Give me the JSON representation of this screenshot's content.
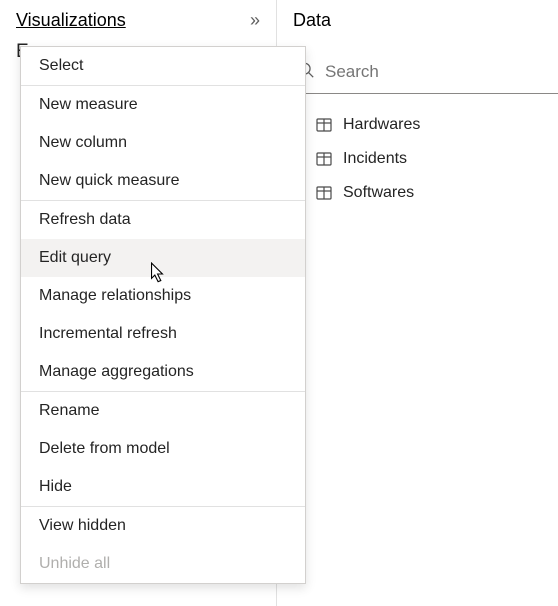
{
  "viz_pane": {
    "title": "Visualizations",
    "partial": "E"
  },
  "data_pane": {
    "title": "Data",
    "search_placeholder": "Search"
  },
  "tables": [
    {
      "label": "Hardwares"
    },
    {
      "label": "Incidents"
    },
    {
      "label": "Softwares"
    }
  ],
  "context_menu": {
    "items": [
      {
        "label": "Select",
        "disabled": false,
        "sep_after": true
      },
      {
        "label": "New measure",
        "disabled": false
      },
      {
        "label": "New column",
        "disabled": false
      },
      {
        "label": "New quick measure",
        "disabled": false,
        "sep_after": true
      },
      {
        "label": "Refresh data",
        "disabled": false
      },
      {
        "label": "Edit query",
        "disabled": false,
        "hover": true
      },
      {
        "label": "Manage relationships",
        "disabled": false
      },
      {
        "label": "Incremental refresh",
        "disabled": false
      },
      {
        "label": "Manage aggregations",
        "disabled": false,
        "sep_after": true
      },
      {
        "label": "Rename",
        "disabled": false
      },
      {
        "label": "Delete from model",
        "disabled": false
      },
      {
        "label": "Hide",
        "disabled": false,
        "sep_after": true
      },
      {
        "label": "View hidden",
        "disabled": false
      },
      {
        "label": "Unhide all",
        "disabled": true
      }
    ]
  }
}
